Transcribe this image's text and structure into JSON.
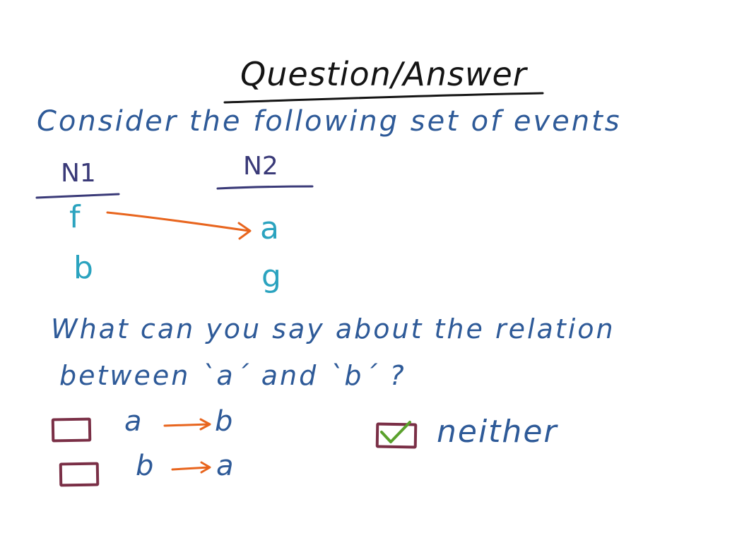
{
  "title": "Question/Answer",
  "intro": "Consider the following set of events",
  "nodes": {
    "n1": {
      "label": "N1",
      "events": [
        "f",
        "b"
      ]
    },
    "n2": {
      "label": "N2",
      "events": [
        "a",
        "g"
      ]
    }
  },
  "question": {
    "line1": "What can you say about the relation",
    "line2": "between `a´ and `b´ ?"
  },
  "options": [
    {
      "from": "a",
      "to": "b",
      "checked": false
    },
    {
      "from": "b",
      "to": "a",
      "checked": false
    },
    {
      "label": "neither",
      "checked": true
    }
  ],
  "colors": {
    "title": "#141414",
    "text": "#2e5a98",
    "node_labels": "#3a3a78",
    "events": "#2ba3bf",
    "arrows": "#e8651e",
    "checkbox": "#7a2f46",
    "checkmark": "#5aa12c"
  }
}
